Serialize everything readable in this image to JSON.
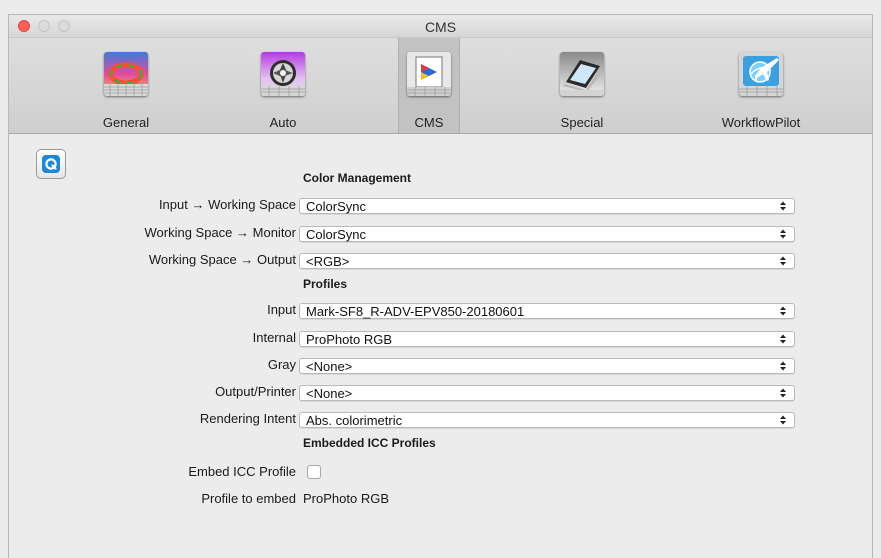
{
  "window": {
    "title": "CMS"
  },
  "toolbar": {
    "tabs": [
      {
        "label": "General",
        "icon": "color-wheel-icon"
      },
      {
        "label": "Auto",
        "icon": "aperture-icon"
      },
      {
        "label": "CMS",
        "icon": "color-profile-icon",
        "selected": true
      },
      {
        "label": "Special",
        "icon": "scanner-icon"
      },
      {
        "label": "WorkflowPilot",
        "icon": "airplane-globe-icon"
      }
    ]
  },
  "sections": {
    "color_management": "Color Management",
    "profiles": "Profiles",
    "embedded": "Embedded ICC Profiles"
  },
  "color_management": {
    "input_to_working": {
      "label": "Input → Working Space",
      "value": "ColorSync"
    },
    "working_to_monitor": {
      "label": "Working Space → Monitor",
      "value": "ColorSync"
    },
    "working_to_output": {
      "label": "Working Space → Output",
      "value": "<RGB>"
    }
  },
  "profiles": {
    "input": {
      "label": "Input",
      "value": "Mark-SF8_R-ADV-EPV850-20180601"
    },
    "internal": {
      "label": "Internal",
      "value": "ProPhoto RGB"
    },
    "gray": {
      "label": "Gray",
      "value": "<None>"
    },
    "output_printer": {
      "label": "Output/Printer",
      "value": "<None>"
    },
    "rendering_intent": {
      "label": "Rendering Intent",
      "value": "Abs. colorimetric"
    }
  },
  "embedded": {
    "embed_icc": {
      "label": "Embed ICC Profile",
      "checked": false
    },
    "profile_to_embed": {
      "label": "Profile to embed",
      "value": "ProPhoto RGB"
    }
  },
  "colors": {
    "close": "#fc5f57",
    "help_accent": "#1e88d8"
  }
}
